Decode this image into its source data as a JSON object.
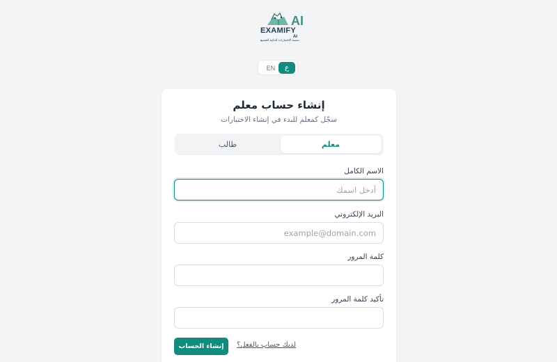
{
  "logo": {
    "word": "EXAMIFY",
    "ai": "AI",
    "sub_ai": "AI",
    "tagline": "منصة الاختبارات الذكية للجميع"
  },
  "language": {
    "en_label": "EN",
    "ar_label": "ع",
    "active": "ar"
  },
  "card": {
    "title": "إنشاء حساب معلم",
    "subtitle": "سجّل كمعلم للبدء في إنشاء الاختبارات"
  },
  "role_tabs": {
    "teacher": "معلم",
    "student": "طالب",
    "selected": "teacher"
  },
  "form": {
    "full_name": {
      "label": "الاسم الكامل",
      "placeholder": "أدخل اسمك",
      "value": ""
    },
    "email": {
      "label": "البريد الإلكتروني",
      "placeholder": "example@domain.com",
      "value": ""
    },
    "password": {
      "label": "كلمة المرور",
      "placeholder": "",
      "value": ""
    },
    "confirm_password": {
      "label": "تأكيد كلمة المرور",
      "placeholder": "",
      "value": ""
    }
  },
  "actions": {
    "submit": "إنشاء الحساب",
    "login_link": "لديك حساب بالفعل؟"
  },
  "colors": {
    "accent": "#138a7e",
    "background": "#f3f4f6",
    "card": "#ffffff"
  }
}
